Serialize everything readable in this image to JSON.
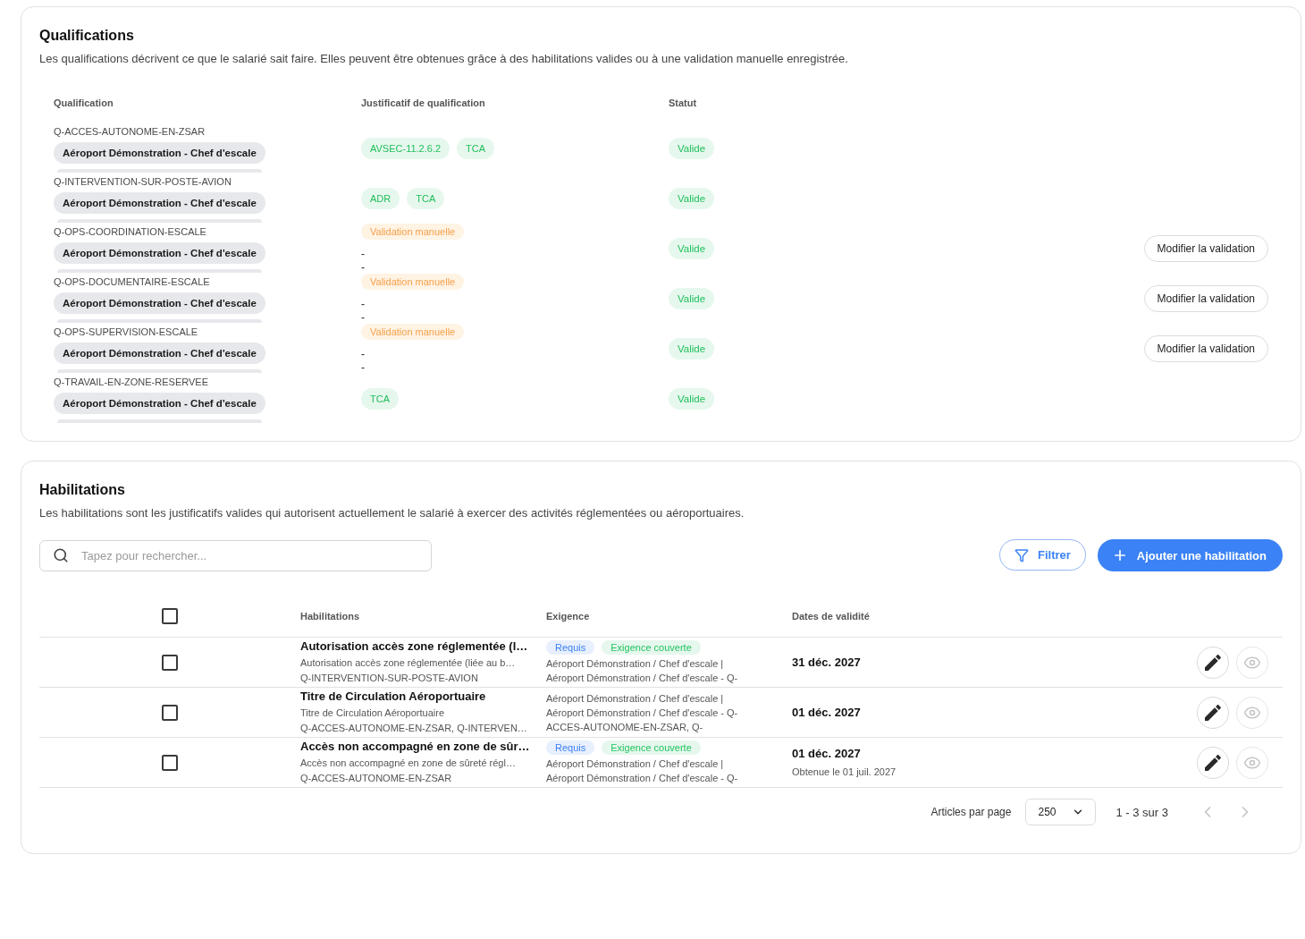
{
  "qualifications": {
    "title": "Qualifications",
    "description": "Les qualifications décrivent ce que le salarié sait faire. Elles peuvent être obtenues grâce à des habilitations valides ou à une validation manuelle enregistrée.",
    "columns": [
      "Qualification",
      "Justificatif de qualification",
      "Statut"
    ],
    "rows": [
      {
        "code": "Q-ACCES-AUTONOME-EN-ZSAR",
        "scope": "Aéroport Démonstration - Chef d'escale",
        "proofs": [
          {
            "label": "AVSEC-11.2.6.2",
            "kind": "habilitation"
          },
          {
            "label": "TCA",
            "kind": "habilitation"
          }
        ],
        "status": {
          "label": "Valide",
          "kind": "valid"
        }
      },
      {
        "code": "Q-INTERVENTION-SUR-POSTE-AVION",
        "scope": "Aéroport Démonstration - Chef d'escale",
        "proofs": [
          {
            "label": "ADR",
            "kind": "habilitation"
          },
          {
            "label": "TCA",
            "kind": "habilitation"
          }
        ],
        "status": {
          "label": "Valide",
          "kind": "valid"
        }
      },
      {
        "code": "Q-OPS-COORDINATION-ESCALE",
        "scope": "Aéroport Démonstration - Chef d'escale",
        "proofs": [
          {
            "label": "Validation manuelle",
            "kind": "manual"
          }
        ],
        "notes": [
          "-",
          "-"
        ],
        "status": {
          "label": "Valide",
          "kind": "valid"
        },
        "action": "Modifier la validation"
      },
      {
        "code": "Q-OPS-DOCUMENTAIRE-ESCALE",
        "scope": "Aéroport Démonstration - Chef d'escale",
        "proofs": [
          {
            "label": "Validation manuelle",
            "kind": "manual"
          }
        ],
        "notes": [
          "-",
          "-"
        ],
        "status": {
          "label": "Valide",
          "kind": "valid"
        },
        "action": "Modifier la validation"
      },
      {
        "code": "Q-OPS-SUPERVISION-ESCALE",
        "scope": "Aéroport Démonstration - Chef d'escale",
        "proofs": [
          {
            "label": "Validation manuelle",
            "kind": "manual"
          }
        ],
        "notes": [
          "-",
          "-"
        ],
        "status": {
          "label": "Valide",
          "kind": "valid"
        },
        "action": "Modifier la validation"
      },
      {
        "code": "Q-TRAVAIL-EN-ZONE-RESERVEE",
        "scope": "Aéroport Démonstration - Chef d'escale",
        "proofs": [
          {
            "label": "TCA",
            "kind": "habilitation"
          }
        ],
        "status": {
          "label": "Valide",
          "kind": "valid"
        }
      }
    ]
  },
  "habilitations": {
    "title": "Habilitations",
    "description": "Les habilitations sont les justificatifs valides qui autorisent actuellement le salarié à exercer des activités réglementées ou aéroportuaires.",
    "search": {
      "placeholder": "Tapez pour rechercher..."
    },
    "filter_button": "Filtrer",
    "add_button": "Ajouter une habilitation",
    "select_all": {
      "checked": false
    },
    "columns": [
      "Habilitations",
      "Exigence",
      "Dates de validité"
    ],
    "rows": [
      {
        "checked": false,
        "title": "Autorisation accès zone réglementée (l…",
        "description": "Autorisation accès zone réglementée (liée au b…",
        "qualifications": "Q-INTERVENTION-SUR-POSTE-AVION",
        "tags": [
          {
            "label": "Requis",
            "kind": "required"
          },
          {
            "label": "Exigence couverte",
            "kind": "covered"
          }
        ],
        "requirement_lines": [
          "Aéroport Démonstration / Chef d'escale |",
          "Aéroport Démonstration / Chef d'escale - Q-"
        ],
        "valid_until": "31 déc. 2027",
        "view_disabled": true
      },
      {
        "checked": false,
        "title": "Titre de Circulation Aéroportuaire",
        "description": "Titre de Circulation Aéroportuaire",
        "qualifications": "Q-ACCES-AUTONOME-EN-ZSAR, Q-INTERVEN…",
        "requirement_lines": [
          "Aéroport Démonstration / Chef d'escale |",
          "Aéroport Démonstration / Chef d'escale - Q-",
          "ACCES-AUTONOME-EN-ZSAR, Q-"
        ],
        "valid_until": "01 déc. 2027",
        "view_disabled": true
      },
      {
        "checked": false,
        "title": "Accès non accompagné en zone de sûr…",
        "description": "Accès non accompagné en zone de sûreté régl…",
        "qualifications": "Q-ACCES-AUTONOME-EN-ZSAR",
        "tags": [
          {
            "label": "Requis",
            "kind": "required"
          },
          {
            "label": "Exigence couverte",
            "kind": "covered"
          }
        ],
        "requirement_lines": [
          "Aéroport Démonstration / Chef d'escale |",
          "Aéroport Démonstration / Chef d'escale - Q-"
        ],
        "valid_until": "01 déc. 2027",
        "obtained": "Obtenue le 01 juil. 2027",
        "view_disabled": true
      }
    ],
    "pagination": {
      "per_page_label": "Articles par page",
      "per_page": "250",
      "range": "1 - 3 sur 3",
      "prev": {
        "disabled": true
      },
      "next": {
        "disabled": true
      }
    }
  }
}
